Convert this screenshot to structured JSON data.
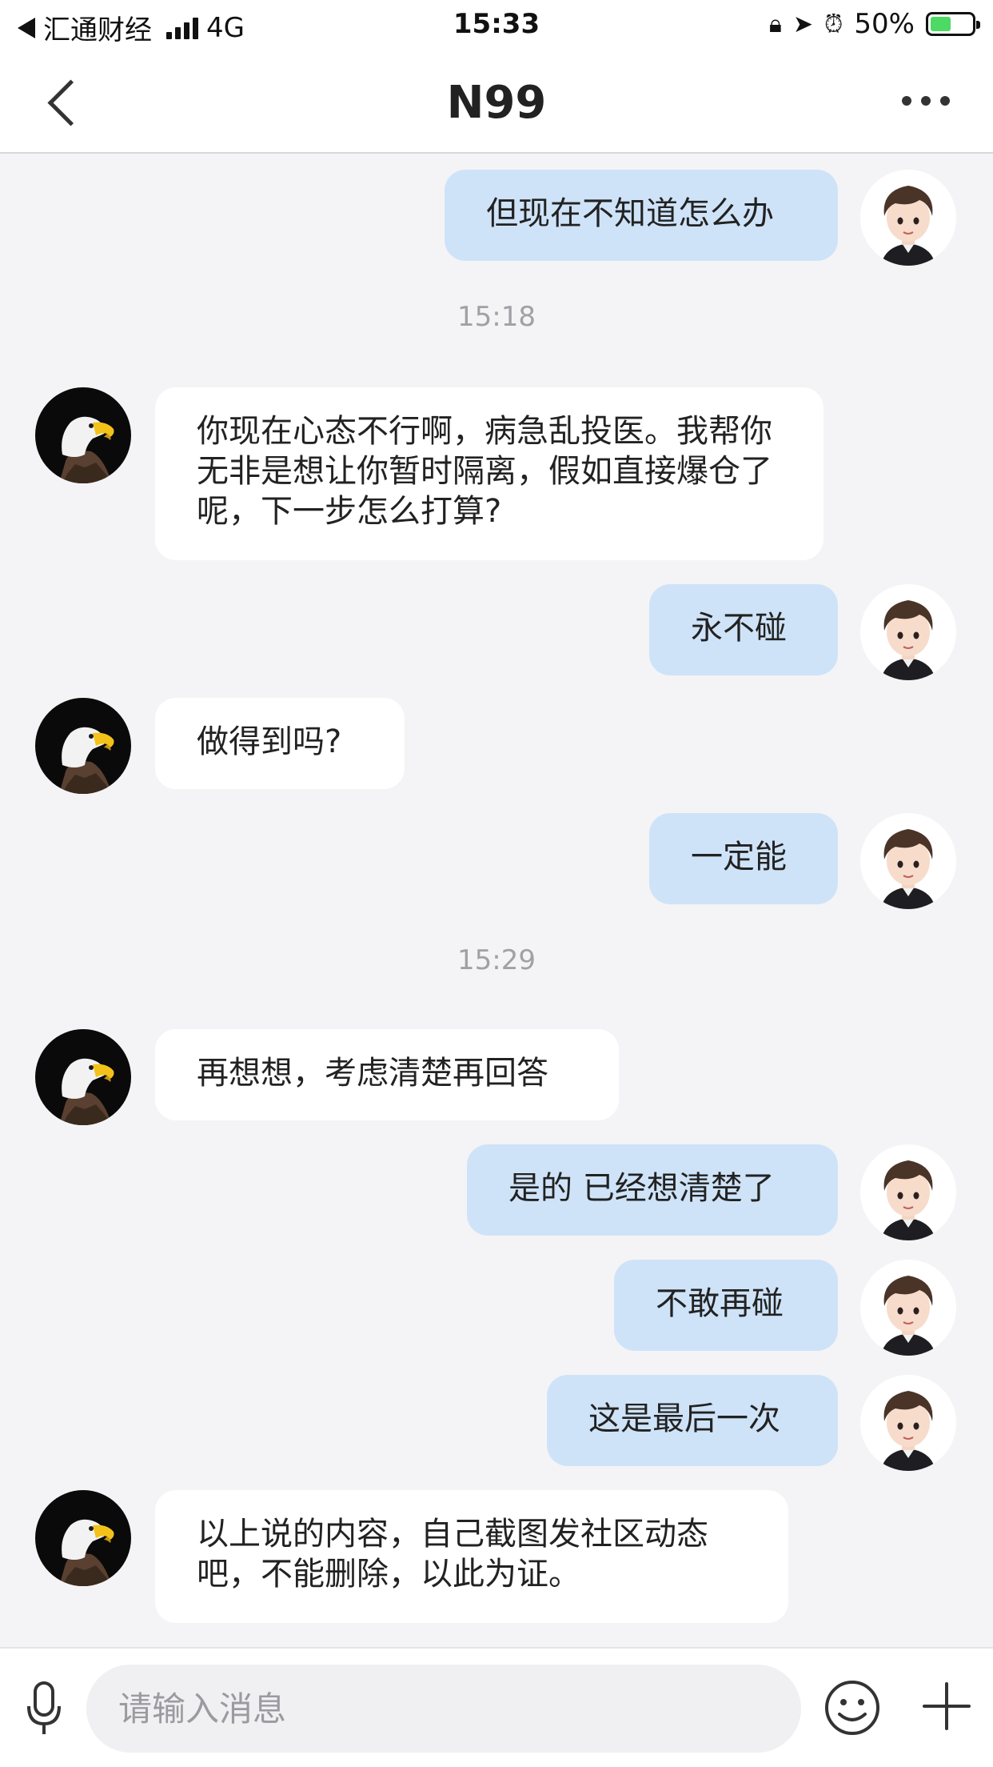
{
  "status_bar": {
    "carrier": "汇通财经",
    "network": "4G",
    "time": "15:33",
    "battery": "50%",
    "battery_level": 0.5
  },
  "header": {
    "title": "N99"
  },
  "messages": {
    "m1": "但现在不知道怎么办",
    "t1": "15:18",
    "m2": "你现在心态不行啊，病急乱投医。我帮你无非是想让你暂时隔离，假如直接爆仓了呢，下一步怎么打算?",
    "m3": "永不碰",
    "m4": "做得到吗?",
    "m5": "一定能",
    "t2": "15:29",
    "m6": "再想想，考虑清楚再回答",
    "m7": "是的 已经想清楚了",
    "m8": "不敢再碰",
    "m9": "这是最后一次",
    "m10": "以上说的内容，自己截图发社区动态吧，不能删除，以此为证。"
  },
  "input": {
    "placeholder": "请输入消息"
  },
  "icons": {
    "back": "chevron-left-icon",
    "more": "more-dots-icon",
    "mic": "microphone-icon",
    "emoji": "emoji-icon",
    "plus": "plus-icon"
  },
  "colors": {
    "my_bubble": "#cfe3f8",
    "their_bubble": "#ffffff",
    "background": "#f4f4f6",
    "battery_fill": "#4cd964"
  }
}
